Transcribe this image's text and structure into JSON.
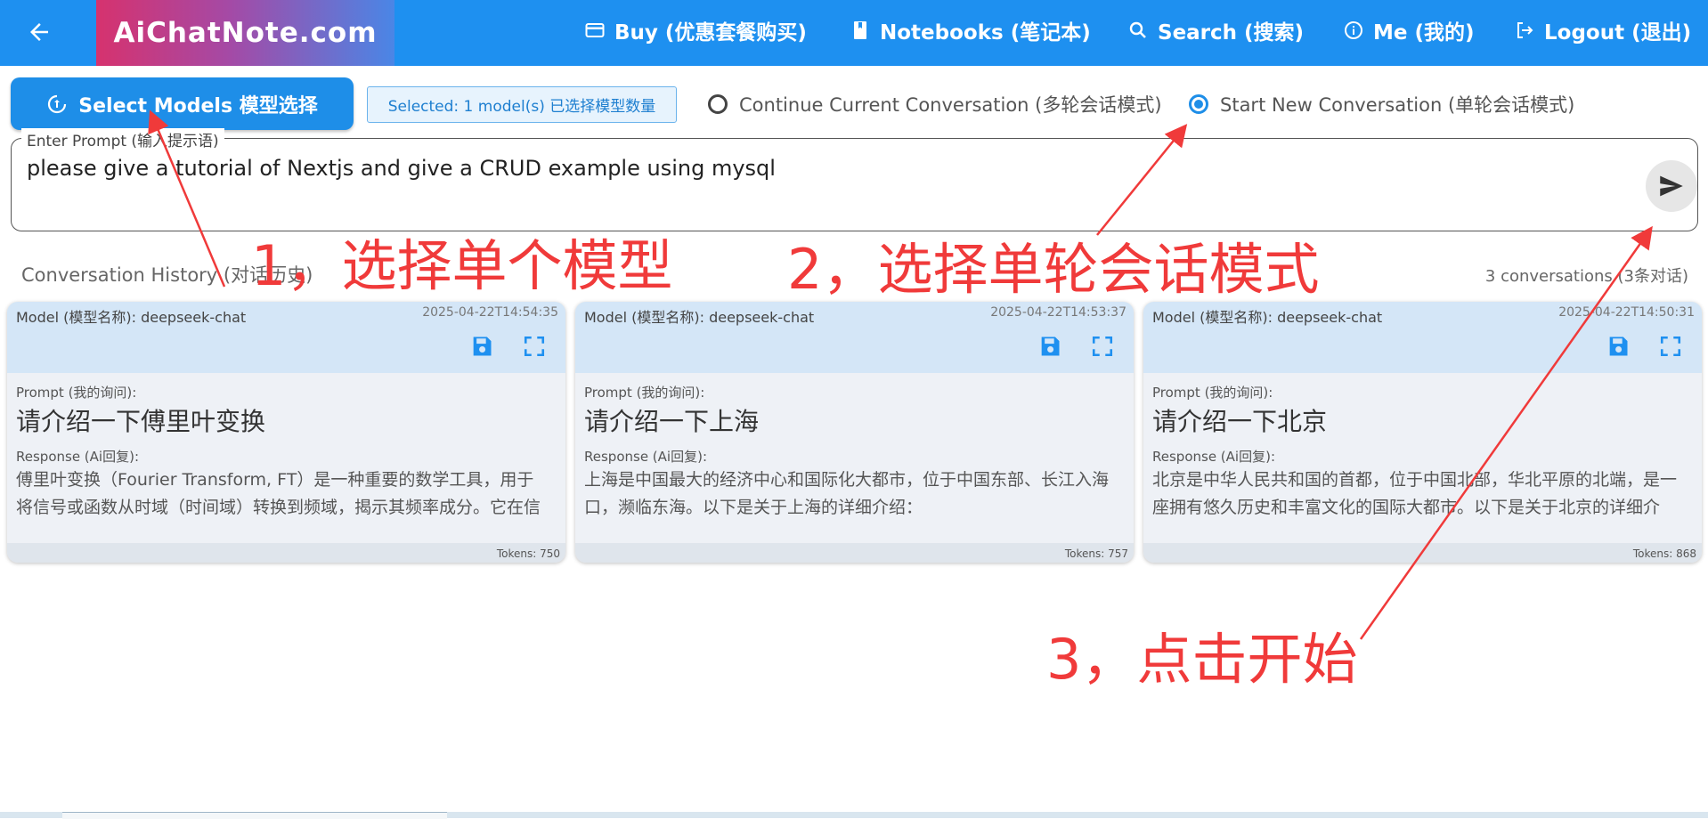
{
  "header": {
    "logo": "AiChatNote.com",
    "nav": [
      {
        "label": "Buy (优惠套餐购买)",
        "icon": "credit-card-icon"
      },
      {
        "label": "Notebooks (笔记本)",
        "icon": "book-icon"
      },
      {
        "label": "Search (搜索)",
        "icon": "search-icon"
      },
      {
        "label": "Me (我的)",
        "icon": "info-icon"
      },
      {
        "label": "Logout (退出)",
        "icon": "logout-icon"
      }
    ]
  },
  "controls": {
    "select_models_label": "Select Models 模型选择",
    "selected_chip": "Selected: 1 model(s) 已选择模型数量",
    "radio_continue": "Continue Current Conversation (多轮会话模式)",
    "radio_new": "Start New Conversation (单轮会话模式)",
    "radio_selected": "new"
  },
  "prompt": {
    "legend": "Enter Prompt (输入提示语)",
    "value": "please give a tutorial of Nextjs and give a CRUD example using mysql"
  },
  "history": {
    "title": "Conversation History (对话历史)",
    "count": "3 conversations (3条对话)",
    "prompt_label": "Prompt (我的询问):",
    "response_label": "Response (Ai回复):",
    "cards": [
      {
        "model": "Model (模型名称): deepseek-chat",
        "time": "2025-04-22T14:54:35",
        "prompt": "请介绍一下傅里叶变换",
        "response": "傅里叶变换（Fourier Transform, FT）是一种重要的数学工具，用于将信号或函数从时域（时间域）转换到频域，揭示其频率成分。它在信号处理、物理学、工程学、图像分析等领域有广泛",
        "tokens": "Tokens: 750"
      },
      {
        "model": "Model (模型名称): deepseek-chat",
        "time": "2025-04-22T14:53:37",
        "prompt": "请介绍一下上海",
        "response": "上海是中国最大的经济中心和国际化大都市，位于中国东部、长江入海口，濒临东海。以下是关于上海的详细介绍：",
        "tokens": "Tokens: 757"
      },
      {
        "model": "Model (模型名称): deepseek-chat",
        "time": "2025-04-22T14:50:31",
        "prompt": "请介绍一下北京",
        "response": "北京是中华人民共和国的首都，位于中国北部，华北平原的北端，是一座拥有悠久历史和丰富文化的国际大都市。以下是关于北京的详细介绍：",
        "tokens": "Tokens: 868"
      }
    ]
  },
  "annotations": {
    "step1": "1，选择单个模型",
    "step2": "2，选择单轮会话模式",
    "step3": "3，点击开始",
    "color": "#f03a3a"
  },
  "colors": {
    "primary": "#1e90f0",
    "card_head": "#d4e6f7"
  }
}
